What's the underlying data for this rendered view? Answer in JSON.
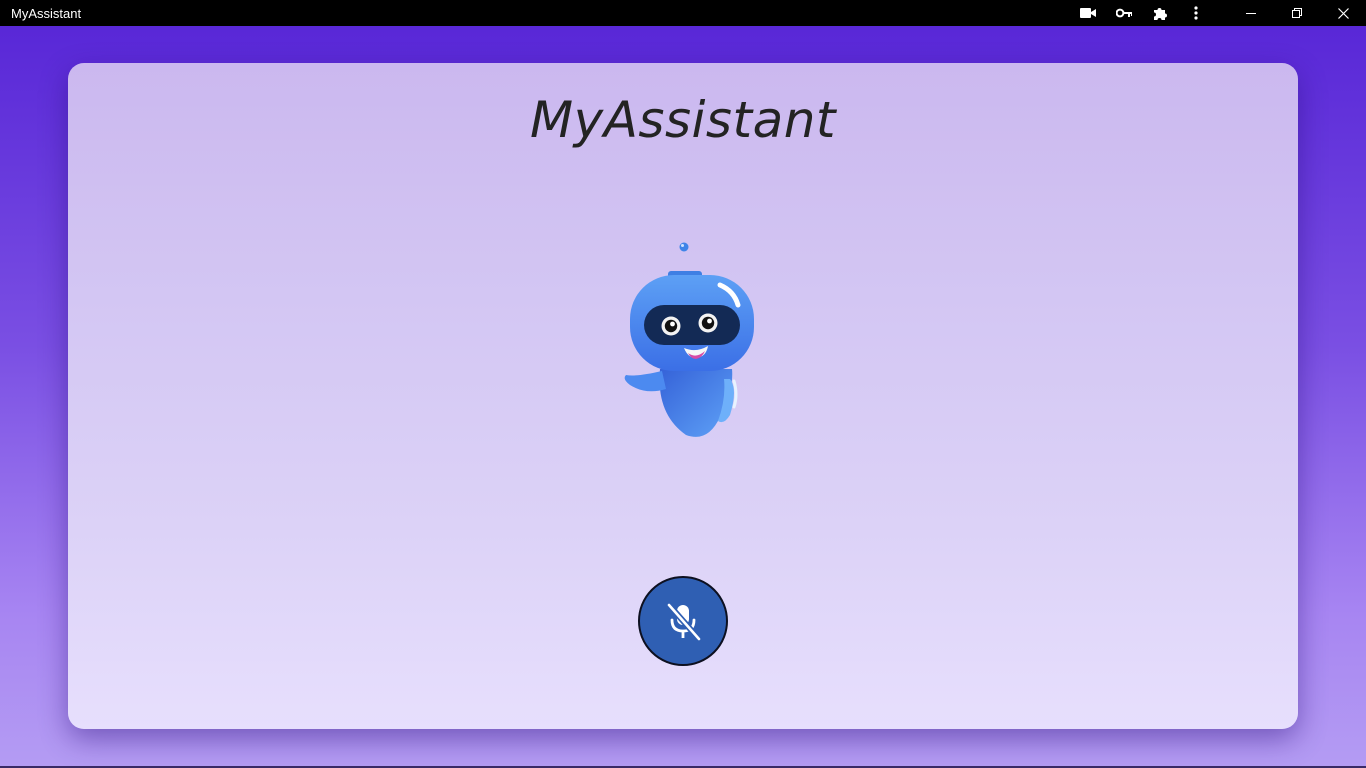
{
  "window": {
    "title": "MyAssistant",
    "toolbar_icons": [
      "video-camera-icon",
      "key-icon",
      "puzzle-extension-icon",
      "more-vert-icon"
    ],
    "controls": [
      "minimize-icon",
      "restore-icon",
      "close-icon"
    ]
  },
  "main": {
    "heading": "MyAssistant",
    "mascot": "robot-assistant",
    "mic_button": {
      "icon": "mic-off-icon",
      "state": "muted"
    }
  },
  "colors": {
    "accent": "#2f5fb3",
    "background_top": "#5624d6",
    "background_bottom": "#b49cf3",
    "card_top": "#cbb8ef",
    "card_bottom": "#e7dffd"
  }
}
